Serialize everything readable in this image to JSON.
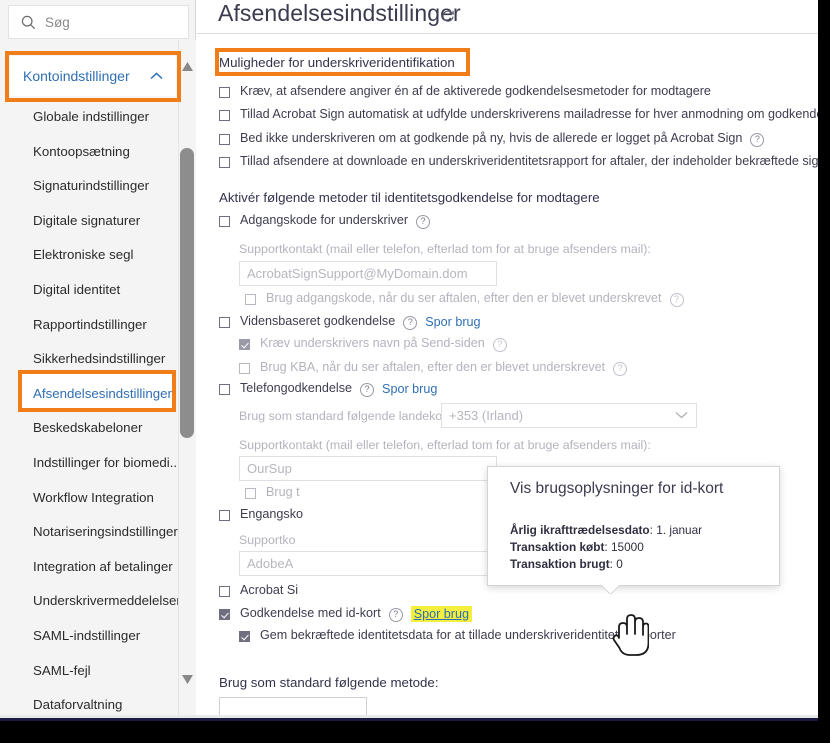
{
  "sidebar": {
    "search": {
      "placeholder": "Søg",
      "icon": "search-icon"
    },
    "account_header": {
      "label": "Kontoindstillinger",
      "icon": "chevron-up-icon"
    },
    "items": [
      {
        "label": "Globale indstillinger",
        "active": false
      },
      {
        "label": "Kontoopsætning",
        "active": false
      },
      {
        "label": "Signaturindstillinger",
        "active": false
      },
      {
        "label": "Digitale signaturer",
        "active": false
      },
      {
        "label": "Elektroniske segl",
        "active": false
      },
      {
        "label": "Digital identitet",
        "active": false
      },
      {
        "label": "Rapportindstillinger",
        "active": false
      },
      {
        "label": "Sikkerhedsindstillinger",
        "active": false
      },
      {
        "label": "Afsendelsesindstillinger",
        "active": true
      },
      {
        "label": "Beskedskabeloner",
        "active": false
      },
      {
        "label": "Indstillinger for biomedi...",
        "active": false
      },
      {
        "label": "Workflow Integration",
        "active": false
      },
      {
        "label": "Notariseringsindstillinger",
        "active": false
      },
      {
        "label": "Integration af betalinger",
        "active": false
      },
      {
        "label": "Underskrivermeddelelser",
        "active": false
      },
      {
        "label": "SAML-indstillinger",
        "active": false
      },
      {
        "label": "SAML-fejl",
        "active": false
      },
      {
        "label": "Dataforvaltning",
        "active": false
      }
    ],
    "scrollbar": {
      "up_icon": "scroll-up-arrow-icon",
      "down_icon": "scroll-down-arrow-icon"
    }
  },
  "main": {
    "title": "Afsendelsesindstillinger",
    "refresh_icon": "refresh-icon",
    "section_identification": {
      "title": "Muligheder for underskriveridentifikation",
      "options": [
        {
          "label": "Kræv, at afsendere angiver én af de aktiverede godkendelsesmetoder for modtagere",
          "checked": false,
          "help": false
        },
        {
          "label": "Tillad Acrobat Sign automatisk at udfylde underskriverens mailadresse for hver anmodning om godkendelse",
          "checked": false,
          "help": false
        },
        {
          "label": "Bed ikke underskriveren om at godkende på ny, hvis de allerede er logget på Acrobat Sign",
          "checked": false,
          "help": true
        },
        {
          "label": "Tillad afsendere at downloade en underskriveridentitetsrapport for aftaler, der indeholder bekræftede signaturer",
          "checked": false,
          "help": true
        }
      ]
    },
    "section_methods": {
      "title": "Aktivér følgende metoder til identitetsgodkendelse for modtagere",
      "password": {
        "label": "Adgangskode for underskriver",
        "checked": false,
        "support_label": "Supportkontakt (mail eller telefon, efterlad tom for at bruge afsenders mail):",
        "support_value": "AcrobatSignSupport@MyDomain.dom",
        "sub_label": "Brug adgangskode, når du ser aftalen, efter den er blevet underskrevet",
        "sub_checked": false
      },
      "kba": {
        "label": "Vidensbaseret godkendelse",
        "checked": false,
        "track_link": "Spor brug",
        "sub1_label": "Kræv underskrivers navn på Send-siden",
        "sub1_checked": true,
        "sub2_label": "Brug KBA, når du ser aftalen, efter den er blevet underskrevet",
        "sub2_checked": false
      },
      "phone": {
        "label": "Telefongodkendelse",
        "checked": false,
        "track_link": "Spor brug",
        "country_label": "Brug som standard følgende landekode:",
        "country_value": "+353 (Irland)",
        "support_label": "Supportkontakt (mail eller telefon, efterlad tom for at bruge afsenders mail):",
        "support_value": "OurSup",
        "sub_label": "Brug t"
      },
      "otp": {
        "label": "Engangsko",
        "checked": false,
        "support_label": "Supportko",
        "support_value": "AdobeA"
      },
      "acrobat_sign": {
        "label": "Acrobat Si",
        "checked": false
      },
      "govt_id": {
        "label": "Godkendelse med id-kort",
        "checked": true,
        "track_link": "Spor brug",
        "sub_label": "Gem bekræftede identitetsdata for at tillade underskriveridentitetsrapporter",
        "sub_checked": true
      }
    },
    "default_method": {
      "title": "Brug som standard følgende metode:"
    }
  },
  "tooltip": {
    "title": "Vis brugsoplysninger for id-kort",
    "lines": [
      {
        "label": "Årlig ikrafttrædelsesdato",
        "value": "1. januar"
      },
      {
        "label": "Transaktion købt",
        "value": "15000"
      },
      {
        "label": "Transaktion brugt",
        "value": "0"
      }
    ]
  },
  "annotations": {
    "highlight_color": "#f07d18",
    "marker_color": "#f4ee3c"
  }
}
